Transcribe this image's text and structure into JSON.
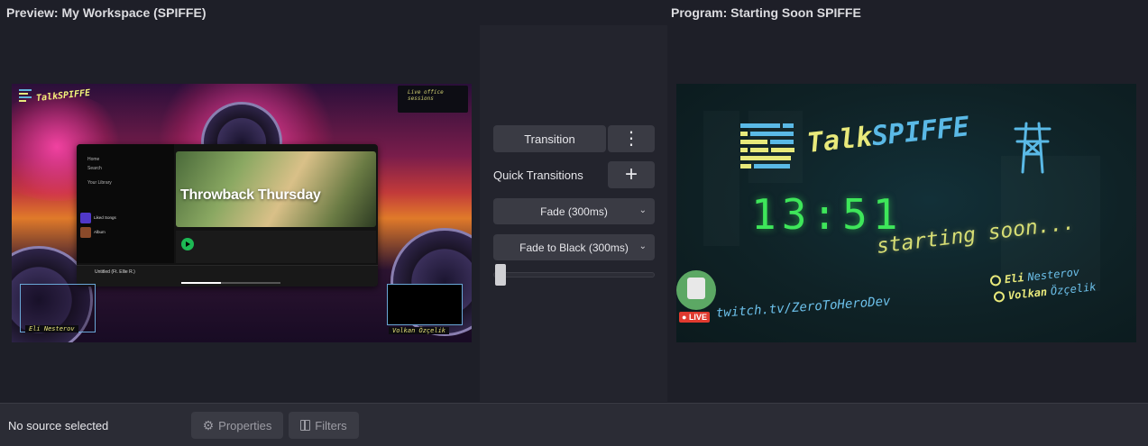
{
  "preview": {
    "title": "Preview: My Workspace (SPIFFE)",
    "logo_text": "TalkSPIFFE",
    "corner_logo_text": "Live office sessions",
    "spotify": {
      "nav_home": "Home",
      "nav_search": "Search",
      "library": "Your Library",
      "hero_title": "Throwback Thursday",
      "liked_songs": "Liked Songs",
      "album_label": "Album",
      "now_playing": "Untitled (Ft. Ellie R.)"
    },
    "left_label": "Eli Nesterov",
    "right_label": "Volkan Özçelik"
  },
  "program": {
    "title": "Program: Starting Soon SPIFFE",
    "talk_part1": "Talk",
    "talk_part2": "SPIFFE",
    "clock": "13:51",
    "starting_soon": "starting soon...",
    "live_badge": "LIVE",
    "twitch_url": "twitch.tv/ZeroToHeroDev",
    "speaker1_first": "Eli",
    "speaker1_last": "Nesterov",
    "speaker2_first": "Volkan",
    "speaker2_last": "Özçelik",
    "accent_yellow": "#e8e97b",
    "accent_blue": "#5ab9e6",
    "clock_color": "#3ee65a"
  },
  "transitions": {
    "transition_button": "Transition",
    "menu_icon": "⋮",
    "quick_label": "Quick Transitions",
    "add_icon": "+",
    "fade": "Fade (300ms)",
    "fade_to_black": "Fade to Black (300ms)",
    "chevron": "⌄",
    "tbar_position": 0
  },
  "bottom": {
    "no_source": "No source selected",
    "properties": "Properties",
    "filters": "Filters"
  }
}
